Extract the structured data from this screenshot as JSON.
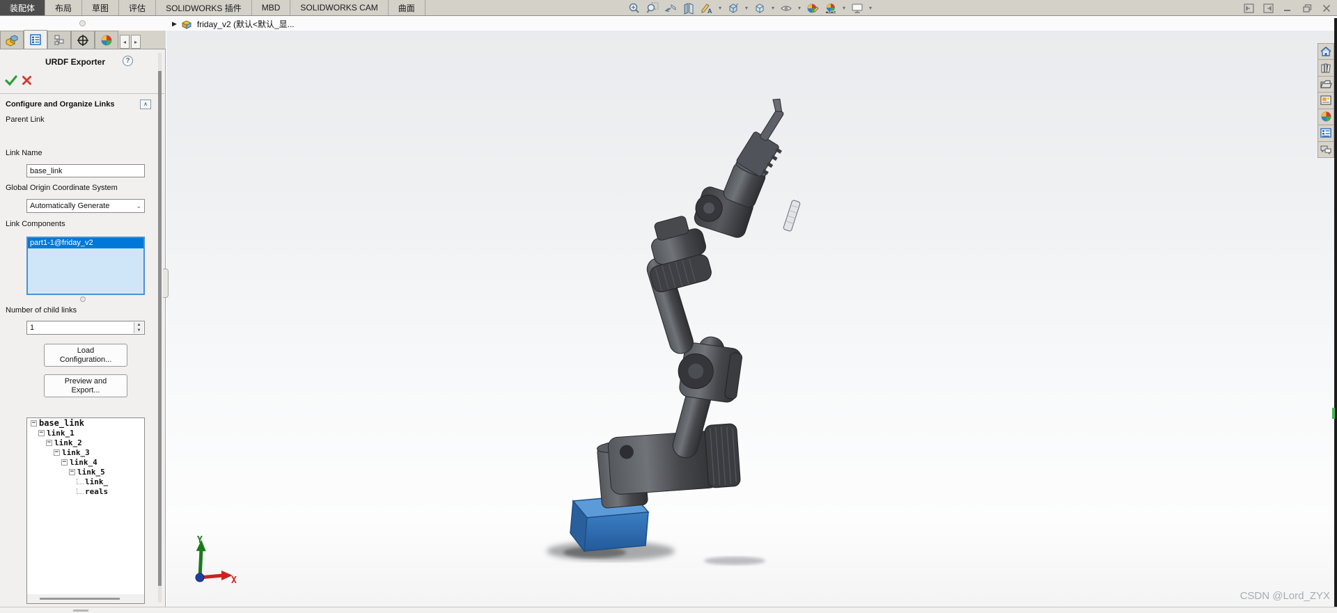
{
  "menu": {
    "tabs": [
      {
        "label": "装配体",
        "active": true
      },
      {
        "label": "布局",
        "active": false
      },
      {
        "label": "草图",
        "active": false
      },
      {
        "label": "评估",
        "active": false
      },
      {
        "label": "SOLIDWORKS 插件",
        "active": false
      },
      {
        "label": "MBD",
        "active": false
      },
      {
        "label": "SOLIDWORKS CAM",
        "active": false
      },
      {
        "label": "曲面",
        "active": false
      }
    ]
  },
  "toolbar": {
    "icons": [
      "zoom-fit",
      "zoom-area",
      "previous-view",
      "section-view",
      "annotation",
      "view-orientation",
      "display-style",
      "hide-show-items",
      "edit-appearance",
      "apply-scene",
      "view-settings"
    ]
  },
  "window_controls": [
    "collapse-pane-left",
    "collapse-pane-right",
    "minimize",
    "restore",
    "close"
  ],
  "breadcrumb": {
    "expand_arrow": "▶",
    "document": "friday_v2  (默认<默认_显..."
  },
  "panel": {
    "tabs": [
      "assembly",
      "property-manager",
      "configuration-manager",
      "dimxpert",
      "appearances"
    ],
    "title": "URDF Exporter",
    "help": "?",
    "section_header": "Configure and Organize Links",
    "collapse_glyph": "∧",
    "parent_link_label": "Parent Link",
    "link_name_label": "Link Name",
    "link_name_value": "base_link",
    "global_origin_label": "Global Origin Coordinate System",
    "global_origin_value": "Automatically Generate",
    "link_components_label": "Link Components",
    "components": [
      "part1-1@friday_v2"
    ],
    "num_children_label": "Number of child links",
    "num_children_value": "1",
    "load_button": "Load Configuration...",
    "preview_button": "Preview and Export...",
    "tree": [
      {
        "label": "base_link",
        "depth": 0,
        "bold": true,
        "leaf": false
      },
      {
        "label": "link_1",
        "depth": 1,
        "bold": false,
        "leaf": false
      },
      {
        "label": "link_2",
        "depth": 2,
        "bold": false,
        "leaf": false
      },
      {
        "label": "link_3",
        "depth": 3,
        "bold": false,
        "leaf": false
      },
      {
        "label": "link_4",
        "depth": 4,
        "bold": false,
        "leaf": false
      },
      {
        "label": "link_5",
        "depth": 5,
        "bold": false,
        "leaf": false
      },
      {
        "label": "link_",
        "depth": 6,
        "bold": false,
        "leaf": true
      },
      {
        "label": "reals",
        "depth": 6,
        "bold": false,
        "leaf": true
      }
    ]
  },
  "viewport": {
    "axis_x": "X",
    "axis_y": "Y",
    "watermark": "CSDN @Lord_ZYX",
    "model": "6-axis robot arm with blue base, dark gray links, detached pin part"
  },
  "taskpane": {
    "icons": [
      "home",
      "design-library",
      "file-explorer",
      "view-palette",
      "appearances",
      "custom-properties",
      "forum"
    ]
  },
  "colors": {
    "selection_blue": "#0078d7",
    "listbox_bg": "#cfe6f8",
    "listbox_border": "#4a90d2",
    "menubar_bg": "#d4d1c9",
    "active_tab_bg": "#4d4d4d",
    "panel_bg": "#f1f0ee",
    "check_green": "#2e9e38",
    "cancel_red": "#d43b2f",
    "confirm_check_pale": "#a8d6a4",
    "confirm_x_pale": "#e3aba4",
    "base_blue": "#2e6db5",
    "axis_x_red": "#cc2222",
    "axis_y_green": "#1a7a1a",
    "watermark_gray": "#a6abb3"
  }
}
